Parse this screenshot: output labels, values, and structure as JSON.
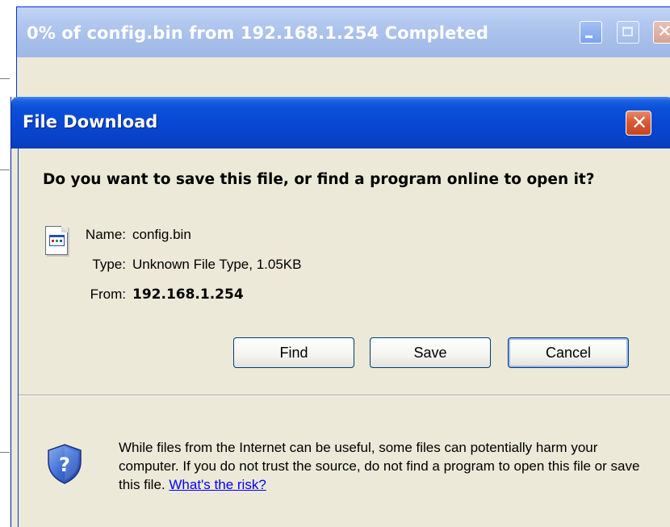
{
  "background_window": {
    "title": "0% of config.bin from 192.168.1.254 Completed",
    "controls": {
      "minimize_icon": "minimize-icon",
      "maximize_icon": "maximize-icon",
      "close_icon": "close-icon"
    }
  },
  "dialog": {
    "title": "File Download",
    "close_icon": "close-icon",
    "question": "Do you want to save this file, or find a program online to open it?",
    "file_icon": "unknown-file-icon",
    "fields": {
      "name_label": "Name:",
      "name_value": "config.bin",
      "type_label": "Type:",
      "type_value": "Unknown File Type, 1.05KB",
      "from_label": "From:",
      "from_value": "192.168.1.254"
    },
    "buttons": {
      "find_label": "Find",
      "save_label": "Save",
      "cancel_label": "Cancel"
    },
    "warning": {
      "icon": "security-shield-question-icon",
      "text": "While files from the Internet can be useful, some files can potentially harm your computer. If you do not trust the source, do not find a program to open this file or save this file.",
      "link_text": "What's the risk?"
    }
  },
  "colors": {
    "titlebar_active": "#0a52d8",
    "titlebar_inactive": "#a5bde9",
    "dialog_face": "#ece9d8",
    "link": "#0000ff",
    "close_button": "#d95a34"
  }
}
